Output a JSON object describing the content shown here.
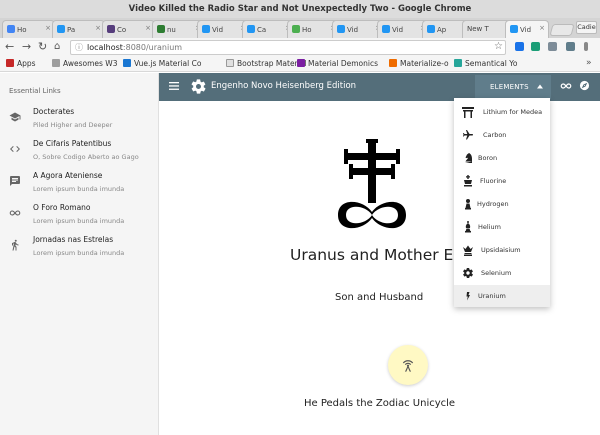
{
  "window": {
    "title": "Video Killed the Radio Star and Not Unexpectedly Two - Google Chrome"
  },
  "tabs": [
    {
      "label": "Ho",
      "color": "#4285f4"
    },
    {
      "label": "Pa",
      "color": "#2196f3"
    },
    {
      "label": "Co",
      "color": "#563d7c"
    },
    {
      "label": "nu",
      "color": "#2e7d32"
    },
    {
      "label": "Vid",
      "color": "#2196f3"
    },
    {
      "label": "Ca",
      "color": "#2196f3"
    },
    {
      "label": "Ho",
      "color": "#4caf50"
    },
    {
      "label": "Vid",
      "color": "#2196f3"
    },
    {
      "label": "Vid",
      "color": "#2196f3"
    },
    {
      "label": "Ap",
      "color": "#2196f3"
    },
    {
      "label": "New T",
      "color": ""
    },
    {
      "label": "Vid",
      "color": "#2196f3"
    }
  ],
  "profile": {
    "label": "Cadie"
  },
  "address": {
    "host": "localhost",
    "path": ":8080/uranium"
  },
  "bookmarks": [
    {
      "label": "Apps",
      "color": "#c62828"
    },
    {
      "label": "Awesomes W3",
      "color": "#9e9e9e"
    },
    {
      "label": "Vue.js Material Co",
      "color": "#1976d2"
    },
    {
      "label": "Bootstrap Material",
      "color": "#e0e0e0"
    },
    {
      "label": "Material Demonics",
      "color": "#7b1fa2"
    },
    {
      "label": "Materialize-o",
      "color": "#ef6c00"
    },
    {
      "label": "Semantical Yo",
      "color": "#26a69a"
    }
  ],
  "drawer": {
    "header": "Essential Links",
    "items": [
      {
        "icon": "school-icon",
        "title": "Docterates",
        "subtitle": "Piled Higher and Deeper"
      },
      {
        "icon": "code-icon",
        "title": "De Cifaris Patentibus",
        "subtitle": "O, Sobre Codigo Aberto ao Gago"
      },
      {
        "icon": "chat-icon",
        "title": "A Agora Ateniense",
        "subtitle": "Lorem ipsum bunda imunda"
      },
      {
        "icon": "infinity-icon",
        "title": "O Foro Romano",
        "subtitle": "Lorem ipsum bunda imunda"
      },
      {
        "icon": "directions-run-icon",
        "title": "Jornadas nas Estrelas",
        "subtitle": "Lorem ipsum bunda imunda"
      }
    ]
  },
  "appbar": {
    "title": "Engenho Novo Heisenberg Edition",
    "elements_label": "ELEMENTS"
  },
  "dropdown": {
    "items": [
      {
        "icon": "torii-icon",
        "label": "Lithium for Medea",
        "selected": false
      },
      {
        "icon": "airplane-icon",
        "label": "Carbon",
        "selected": false
      },
      {
        "icon": "chess-knight-icon",
        "label": "Boron",
        "selected": false
      },
      {
        "icon": "chess-king-icon",
        "label": "Fluorine",
        "selected": false
      },
      {
        "icon": "chess-pawn-icon",
        "label": "Hydrogen",
        "selected": false
      },
      {
        "icon": "chess-bishop-icon",
        "label": "Helium",
        "selected": false
      },
      {
        "icon": "chess-queen-icon",
        "label": "Upsidaisium",
        "selected": false
      },
      {
        "icon": "gear-icon",
        "label": "Selenium",
        "selected": false
      },
      {
        "icon": "bolt-icon",
        "label": "Uranium",
        "selected": true
      }
    ]
  },
  "hero": {
    "title": "Uranus and Mother Ear",
    "subtitle": "Son and Husband",
    "footer": "He Pedals the Zodiac Unicycle"
  }
}
